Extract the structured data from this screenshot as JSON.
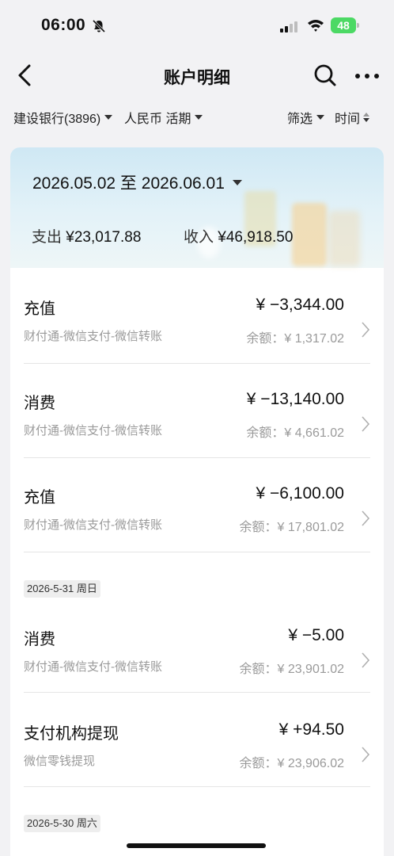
{
  "status": {
    "time": "06:00",
    "battery": "48"
  },
  "nav": {
    "title": "账户明细"
  },
  "filters": {
    "account": "建设银行(3896)",
    "currency": "人民币 活期",
    "filter": "筛选",
    "time": "时间"
  },
  "period": {
    "range": "2026.05.02 至 2026.06.01",
    "expense_label": "支出",
    "expense_value": "¥23,017.88",
    "income_label": "收入",
    "income_value": "¥46,918.50"
  },
  "transactions": [
    {
      "title": "充值",
      "amount": "¥ −3,344.00",
      "sub": "财付通-微信支付-微信转账",
      "balance": "余额：¥ 1,317.02"
    },
    {
      "title": "消费",
      "amount": "¥ −13,140.00",
      "sub": "财付通-微信支付-微信转账",
      "balance": "余额：¥ 4,661.02"
    },
    {
      "title": "充值",
      "amount": "¥ −6,100.00",
      "sub": "财付通-微信支付-微信转账",
      "balance": "余额：¥ 17,801.02"
    },
    {
      "title": "消费",
      "amount": "¥ −5.00",
      "sub": "财付通-微信支付-微信转账",
      "balance": "余额：¥ 23,901.02"
    },
    {
      "title": "支付机构提现",
      "amount": "¥ +94.50",
      "sub": "微信零钱提现",
      "balance": "余额：¥ 23,906.02"
    }
  ],
  "date_groups": [
    "2026-5-31 周日",
    "2026-5-30 周六"
  ],
  "colors": {
    "battery": "#4cd964",
    "background": "#f2f2f4",
    "header_gradient_top": "#cfe8f4"
  }
}
